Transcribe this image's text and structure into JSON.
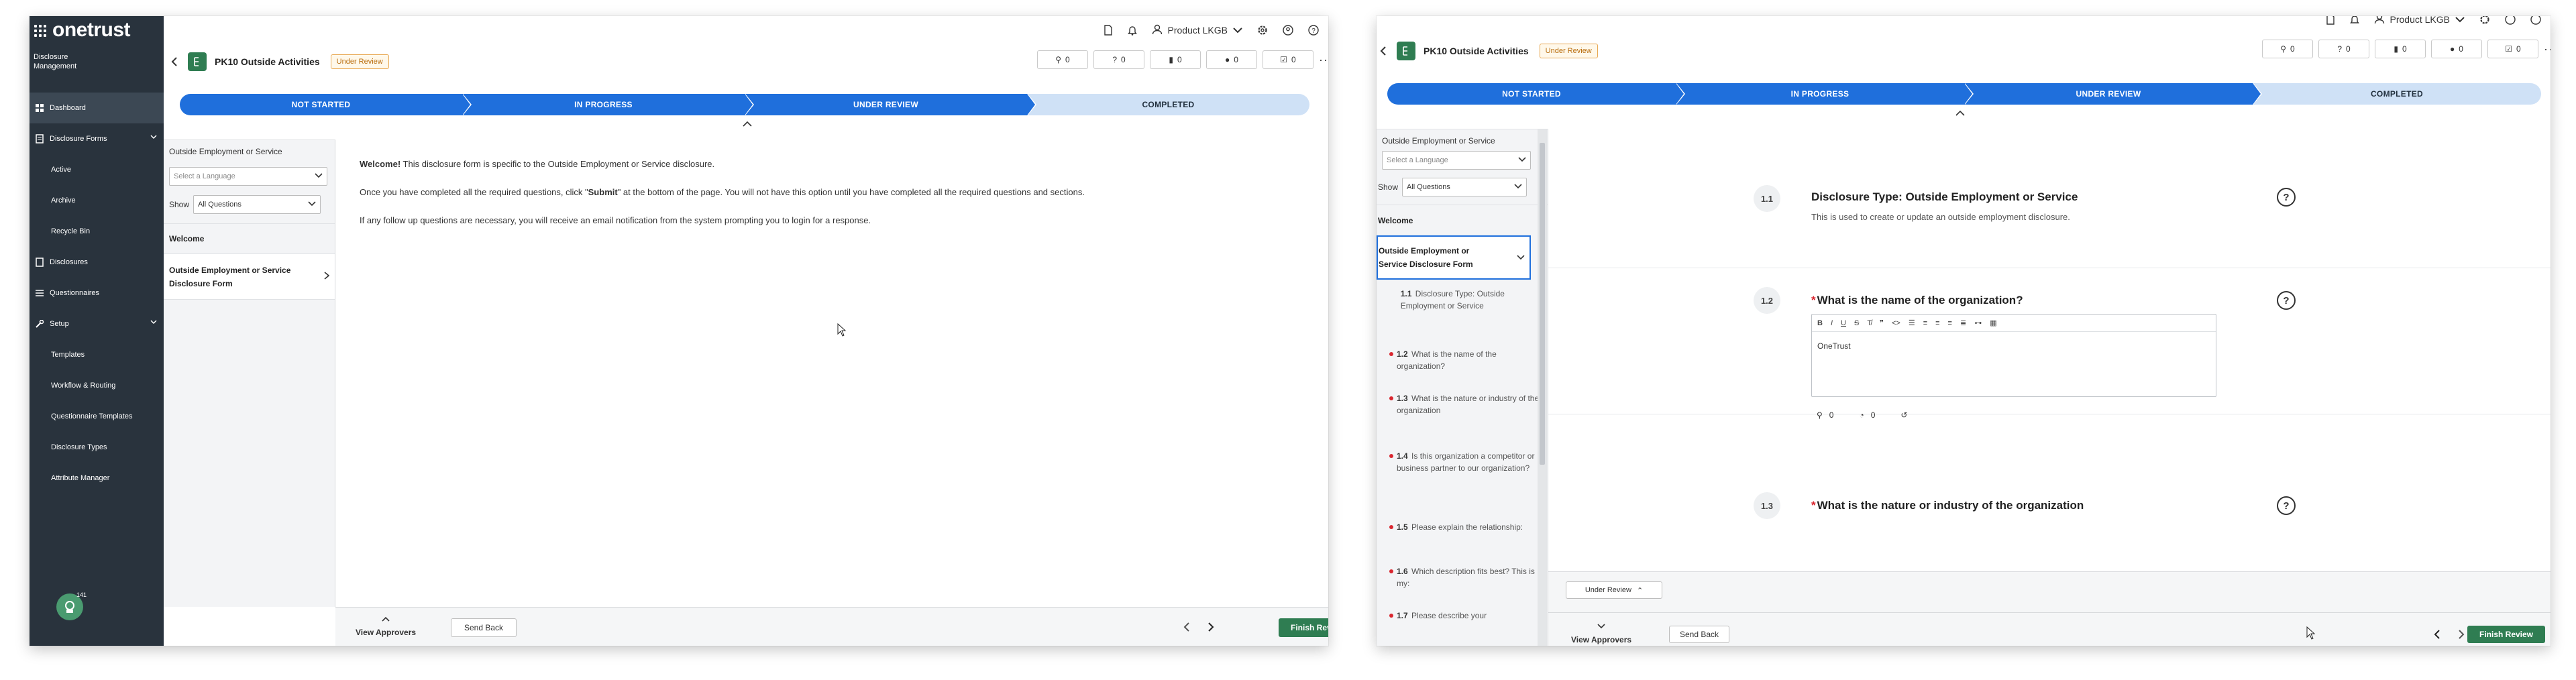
{
  "sidebar": {
    "logo": "onetrust",
    "module": "Disclosure\nManagement",
    "nav": {
      "dashboard": "Dashboard",
      "disclosure_forms": "Disclosure Forms",
      "active": "Active",
      "archive": "Archive",
      "recycle_bin": "Recycle Bin",
      "disclosures": "Disclosures",
      "questionnaires": "Questionnaires",
      "setup": "Setup",
      "templates": "Templates",
      "workflow_routing": "Workflow & Routing",
      "questionnaire_templates": "Questionnaire Templates",
      "disclosure_types": "Disclosure Types",
      "attribute_manager": "Attribute Manager"
    },
    "avatar_badge": "141"
  },
  "topbar": {
    "org": "Product LKGB"
  },
  "record": {
    "title": "PK10 Outside Activities",
    "status": "Under Review"
  },
  "counters": [
    {
      "icon": "paperclip-icon",
      "glyph": "⚲",
      "value": "0"
    },
    {
      "icon": "question-icon",
      "glyph": "?",
      "value": "0"
    },
    {
      "icon": "note-icon",
      "glyph": "▮",
      "value": "0"
    },
    {
      "icon": "comment-icon",
      "glyph": "●",
      "value": "0"
    },
    {
      "icon": "task-icon",
      "glyph": "☑",
      "value": "0"
    }
  ],
  "stepper": [
    "NOT STARTED",
    "IN PROGRESS",
    "UNDER REVIEW",
    "COMPLETED"
  ],
  "left_panel": {
    "section_title": "Outside Employment or Service",
    "language_placeholder": "Select a Language",
    "show_label": "Show",
    "show_value": "All Questions",
    "welcome": "Welcome",
    "form_section": "Outside Employment or Service Disclosure Form",
    "questions": [
      {
        "num": "1.1",
        "text": "Disclosure Type: Outside Employment or Service",
        "required": false
      },
      {
        "num": "1.2",
        "text": "What is the name of the organization?",
        "required": true
      },
      {
        "num": "1.3",
        "text": "What is the nature or industry of the organization",
        "required": true
      },
      {
        "num": "1.4",
        "text": "Is this organization a competitor or business partner to our organization?",
        "required": true
      },
      {
        "num": "1.5",
        "text": "Please explain the relationship:",
        "required": true
      },
      {
        "num": "1.6",
        "text": "Which description fits best? This is my:",
        "required": true
      },
      {
        "num": "1.7",
        "text": "Please describe your",
        "required": true
      }
    ]
  },
  "welcome_content": {
    "welcome_bold": "Welcome!",
    "welcome_rest": " This disclosure form is specific to the Outside Employment or Service disclosure.",
    "p2_a": "Once you have completed all the required questions, click \"",
    "p2_bold": "Submit",
    "p2_b": "\" at the bottom of the page. You will not have this option until you have completed all the required questions and sections.",
    "p3": "If any follow up questions are necessary, you will receive an email notification from the system prompting you to login for a response."
  },
  "questions": {
    "q1": {
      "num": "1.1",
      "title": "Disclosure Type: Outside Employment or Service",
      "desc": "This is used to create or update an outside employment disclosure."
    },
    "q2": {
      "num": "1.2",
      "title": "What is the name of the organization?",
      "answer": "OneTrust",
      "attachments": "0",
      "comments": "0"
    },
    "q3": {
      "num": "1.3",
      "title": "What is the nature or industry of the organization"
    }
  },
  "footer": {
    "view_approvers": "View Approvers",
    "send_back": "Send Back",
    "finish_review": "Finish Review",
    "status_pill": "Under Review"
  }
}
